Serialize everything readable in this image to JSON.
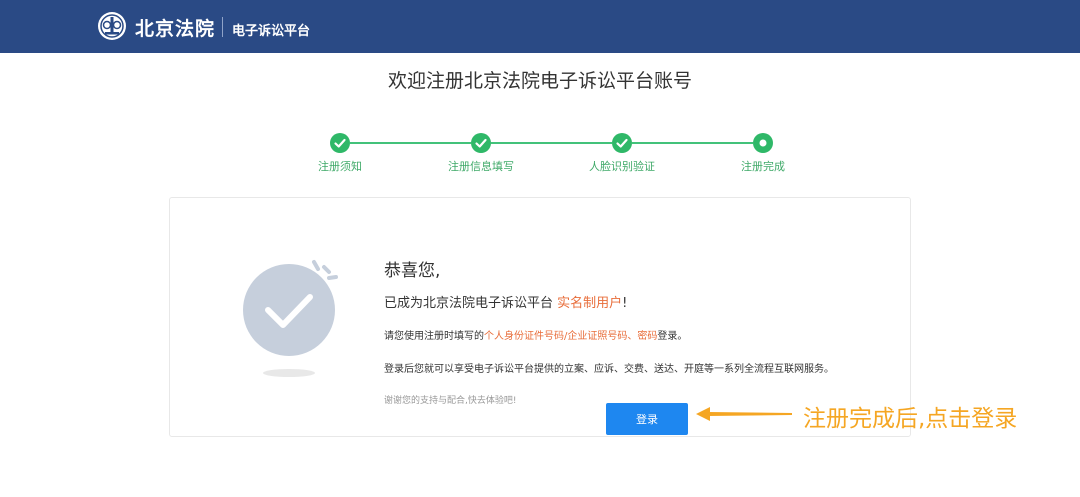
{
  "header": {
    "logo_title": "北京法院",
    "logo_sub": "电子诉讼平台"
  },
  "page_title": "欢迎注册北京法院电子诉讼平台账号",
  "steps": [
    {
      "label": "注册须知",
      "status": "done"
    },
    {
      "label": "注册信息填写",
      "status": "done"
    },
    {
      "label": "人脸识别验证",
      "status": "done"
    },
    {
      "label": "注册完成",
      "status": "current"
    }
  ],
  "result": {
    "congrats": "恭喜您,",
    "line1_prefix": "已成为北京法院电子诉讼平台 ",
    "line1_highlight": "实名制用户",
    "line1_suffix": "!",
    "line2_prefix": "请您使用注册时填写的",
    "line2_highlight": "个人身份证件号码/企业证照号码、密码",
    "line2_suffix": "登录。",
    "line3": "登录后您就可以享受电子诉讼平台提供的立案、应诉、交费、送达、开庭等一系列全流程互联网服务。",
    "line4": "谢谢您的支持与配合,快去体验吧!",
    "login_label": "登录"
  },
  "annotation": "注册完成后,点击登录",
  "colors": {
    "header": "#2a4a85",
    "step_green": "#2fb868",
    "highlight": "#e86d3a",
    "button": "#1e87f0",
    "annotation": "#f5a623"
  }
}
